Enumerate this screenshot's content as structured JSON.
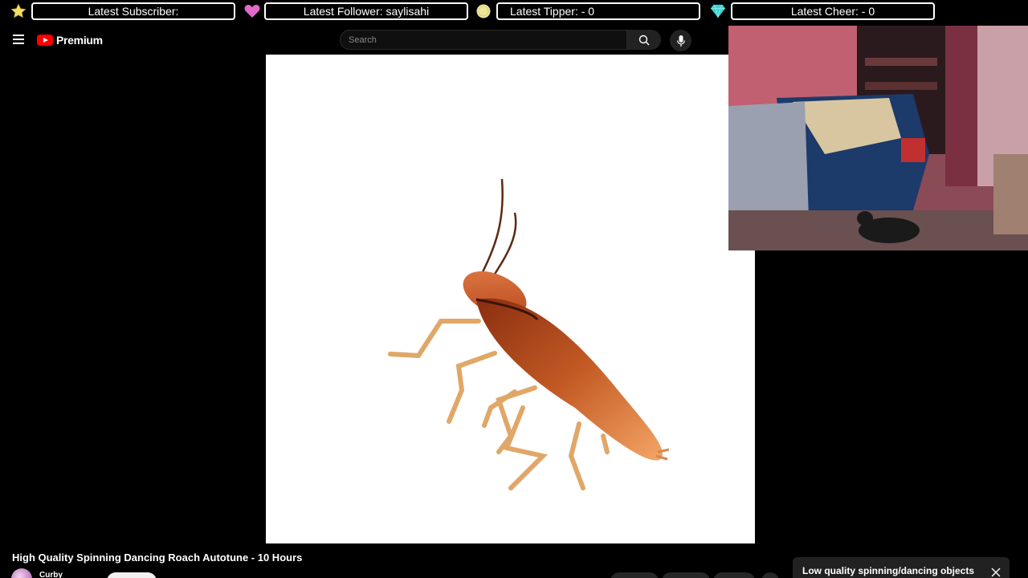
{
  "alerts": {
    "subscriber": "Latest Subscriber:",
    "follower": "Latest Follower: saylisahi",
    "tipper": "Latest Tipper:  - 0",
    "cheer": "Latest Cheer:  - 0"
  },
  "header": {
    "brand": "Premium",
    "search_placeholder": "Search"
  },
  "video": {
    "title": "High Quality Spinning Dancing Roach Autotune - 10 Hours",
    "channel": "Curby"
  },
  "playlist": {
    "title": "Low quality spinning/dancing objects"
  },
  "colors": {
    "brand_red": "#ff0000",
    "roach_body": "#c35a24",
    "heart_pink": "#e06ac8",
    "gem_teal": "#3fd3d0",
    "coin_yellow": "#f0e68c"
  }
}
